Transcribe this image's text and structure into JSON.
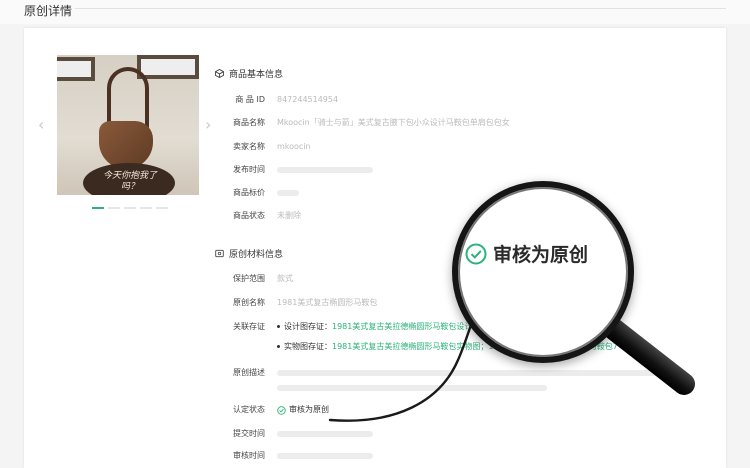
{
  "header": {
    "title": "原创详情"
  },
  "gallery": {
    "board_text": "今天你抱我了吗？",
    "prev_icon": "chevron-left-icon",
    "next_icon": "chevron-right-icon",
    "slide_count": 5,
    "active_slide": 1
  },
  "product_section": {
    "title": "商品基本信息",
    "rows": [
      {
        "label": "商 品 ID",
        "value": "847244514954"
      },
      {
        "label": "商品名称",
        "value": "Mkoocin「骑士与箭」美式复古腋下包小众设计马鞍包单肩包包女"
      },
      {
        "label": "卖家名称",
        "value": "mkoocin"
      },
      {
        "label": "发布时间",
        "value": ""
      },
      {
        "label": "商品标价",
        "value": ""
      },
      {
        "label": "商品状态",
        "value": "未删除"
      }
    ]
  },
  "original_section": {
    "title": "原创材料信息",
    "protect_label": "保护范围",
    "protect_value": "款式",
    "name_label": "原创名称",
    "name_value": "1981美式复古椭圆形马鞍包",
    "cert_label": "关联存证",
    "certs": [
      {
        "label": "设计图存证：",
        "value": "1981美式复古美拉德椭圆形马鞍包设计图"
      },
      {
        "label": "实物图存证：",
        "value": "1981美式复古美拉德椭圆形马鞍包实物图；1981美式复古美拉德椭圆形马鞍包7"
      }
    ],
    "desc_label": "原创描述",
    "status_label": "认定状态",
    "status_value": "审核为原创",
    "submit_label": "提交时间",
    "review_label": "审核时间"
  },
  "magnifier": {
    "text": "审核为原创"
  },
  "colors": {
    "accent": "#2bb37b",
    "text": "#333333",
    "muted": "#bbbbbb",
    "background": "#f4f4f4"
  }
}
